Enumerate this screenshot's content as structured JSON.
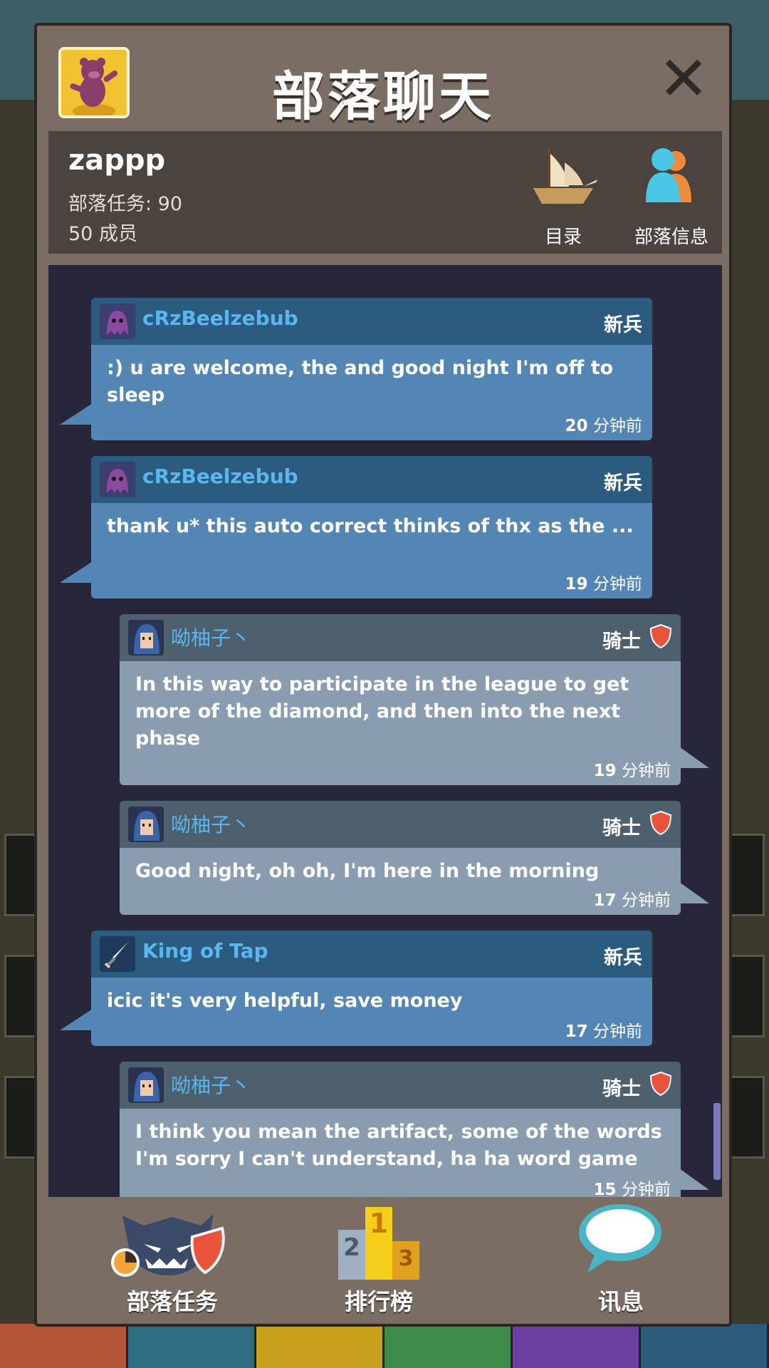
{
  "header": {
    "title": "部落聊天"
  },
  "clan": {
    "name": "zappp",
    "quest_line": "部落任务: 90",
    "members_line": "50 成员",
    "catalog_label": "目录",
    "info_label": "部落信息"
  },
  "messages": [
    {
      "user": "cRzBeelzebub",
      "rank": "新兵",
      "text": ":) u are welcome,  the and good night I'm off to sleep",
      "time_num": "20",
      "time_unit": " 分钟前"
    },
    {
      "user": "cRzBeelzebub",
      "rank": "新兵",
      "text": "thank u* this auto correct thinks of thx as the ...",
      "time_num": "19",
      "time_unit": " 分钟前"
    },
    {
      "user": "呦柚子丶",
      "rank": "骑士",
      "text": "In this way to participate in the league to get more of the diamond, and then into the next phase",
      "time_num": "19",
      "time_unit": " 分钟前"
    },
    {
      "user": "呦柚子丶",
      "rank": "骑士",
      "text": "Good night, oh oh, I'm here in the morning",
      "time_num": "17",
      "time_unit": " 分钟前"
    },
    {
      "user": "King of Tap",
      "rank": "新兵",
      "text": "icic it's very helpful, save money",
      "time_num": "17",
      "time_unit": " 分钟前"
    },
    {
      "user": "呦柚子丶",
      "rank": "骑士",
      "text": "I think you mean the artifact, some of the words I'm sorry I can't understand, ha ha word game",
      "time_num": "15",
      "time_unit": " 分钟前"
    }
  ],
  "nav": {
    "quest_label": "部落任务",
    "leaderboard_label": "排行榜",
    "messages_label": "讯息",
    "podium": [
      "2",
      "1",
      "3"
    ]
  },
  "colors": {
    "own_msg_body": "#5386b4",
    "other_msg_body": "#8a9db0",
    "username": "#58b7ee",
    "modal_bg": "#7a6d63"
  }
}
